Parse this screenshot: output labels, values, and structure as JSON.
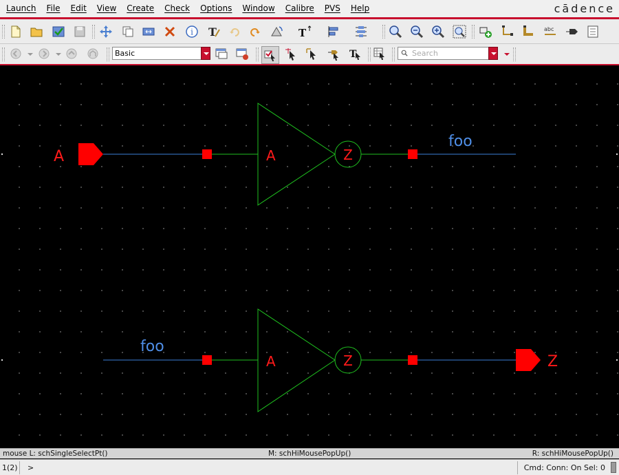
{
  "menu": [
    "Launch",
    "File",
    "Edit",
    "View",
    "Create",
    "Check",
    "Options",
    "Window",
    "Calibre",
    "PVS",
    "Help"
  ],
  "brand": "cādence",
  "toolbar2": {
    "filter_value": "Basic",
    "search_placeholder": "Search"
  },
  "icons": {
    "toolbar1": [
      "new-icon",
      "open-icon",
      "check-save-icon",
      "save-icon",
      "move-icon",
      "copy-icon",
      "stretch-icon",
      "delete-icon",
      "properties-icon",
      "text-edit-icon",
      "undo-icon",
      "redo-icon",
      "rotate-icon",
      "text-size-icon",
      "align-icon",
      "distribute-icon",
      "zoom-in-icon",
      "zoom-out-icon",
      "zoom-fit-icon",
      "zoom-area-icon",
      "add-instance-icon",
      "add-wire-icon",
      "add-bus-icon",
      "add-label-icon",
      "add-pin-icon",
      "descend-icon"
    ],
    "toolbar2": [
      "back-icon",
      "forward-icon",
      "up-icon",
      "home-icon",
      "window-icon",
      "close-window-icon",
      "select-toggle-icon",
      "select-point-icon",
      "select-area-icon",
      "select-pin-icon",
      "select-text-icon",
      "selection-filter-icon"
    ]
  },
  "schematic": {
    "rows": [
      {
        "input_pin": "A",
        "input_net": "",
        "gate_input_pin": "A",
        "gate_output_pin": "Z",
        "output_net": "foo",
        "output_pin": ""
      },
      {
        "input_pin": "",
        "input_net": "foo",
        "gate_input_pin": "A",
        "gate_output_pin": "Z",
        "output_net": "",
        "output_pin": "Z"
      }
    ],
    "colors": {
      "pin": "#ff0000",
      "wire": "#3b7fd9",
      "instance": "#1fc01f",
      "net_label": "#4f8fe8",
      "grid": "#8a8a8a",
      "background": "#000000"
    }
  },
  "status": {
    "left": "mouse L: schSingleSelectPt()",
    "middle": "M: schHiMousePopUp()",
    "right": "R: schHiMousePopUp()"
  },
  "cmdline": {
    "count": "1(2)",
    "prompt": ">",
    "info": "Cmd:   Conn: On  Sel: 0"
  }
}
